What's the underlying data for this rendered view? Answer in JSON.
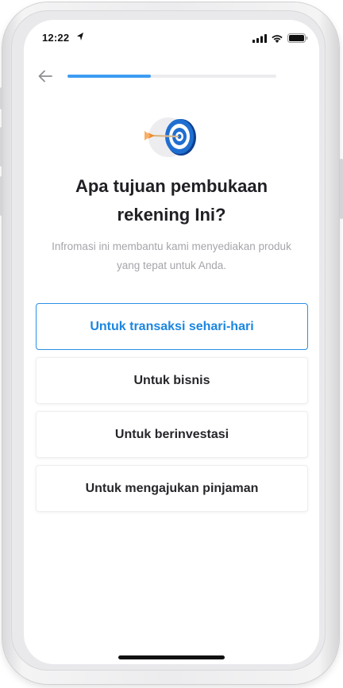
{
  "status_bar": {
    "time": "12:22",
    "icons": [
      "location-arrow-icon",
      "signal-icon",
      "wifi-icon",
      "battery-icon"
    ]
  },
  "header": {
    "back_icon": "arrow-left-icon",
    "progress_fraction": 0.4
  },
  "illustration": {
    "icon": "target-dart-icon"
  },
  "title": "Apa tujuan pembukaan rekening Ini?",
  "subtitle": "Infromasi ini membantu kami menyediakan produk yang tepat untuk Anda.",
  "options": [
    {
      "label": "Untuk transaksi sehari-hari",
      "selected": true
    },
    {
      "label": "Untuk bisnis",
      "selected": false
    },
    {
      "label": "Untuk berinvestasi",
      "selected": false
    },
    {
      "label": "Untuk mengajukan pinjaman",
      "selected": false
    }
  ],
  "colors": {
    "accent": "#2c8fe6",
    "progress": "#3d9df2",
    "title": "#1f1f24",
    "subtitle": "#a5a5ab",
    "target_blue": "#1f6fd0"
  }
}
